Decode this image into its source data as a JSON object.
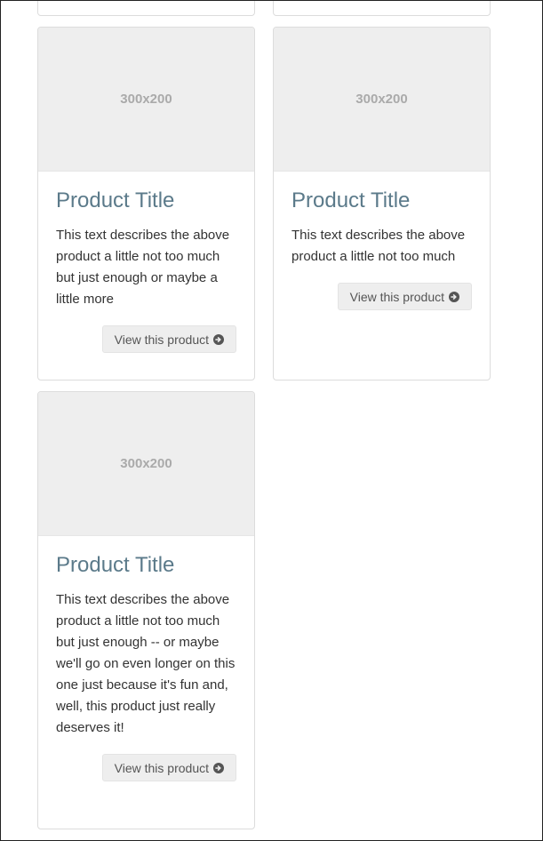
{
  "cards": [
    {
      "image_label": "300x200",
      "title": "Product Title",
      "description": "This text describes the above product a little not too much but just enough or maybe a little more",
      "button_label": "View this product",
      "button_icon": "arrow-circle-right-icon"
    },
    {
      "image_label": "300x200",
      "title": "Product Title",
      "description": "This text describes the above product a little not too much",
      "button_label": "View this product",
      "button_icon": "arrow-circle-right-icon"
    },
    {
      "image_label": "300x200",
      "title": "Product Title",
      "description": "This text describes the above product a little not too much but just enough -- or maybe we'll go on even longer on this one just because it's fun and, well, this product just really deserves it!",
      "button_label": "View this product",
      "button_icon": "arrow-circle-right-icon"
    }
  ],
  "colors": {
    "title": "#5b7a8a",
    "thumb_bg": "#eeeeee",
    "button_bg": "#eeeeee",
    "card_border": "#dcdcdc"
  }
}
